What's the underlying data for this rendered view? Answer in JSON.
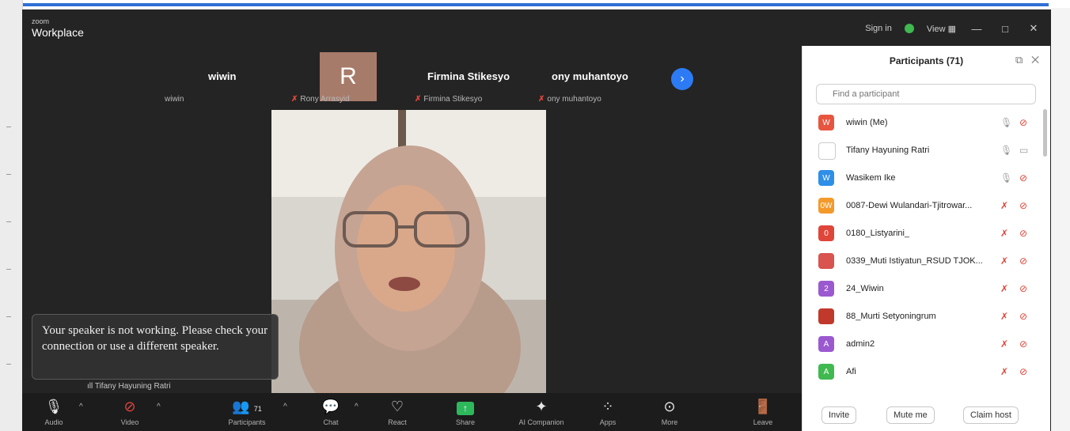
{
  "window": {
    "brand_small": "zoom",
    "brand_big": "Workplace",
    "sign_in": "Sign in",
    "view": "View",
    "minimize": "—",
    "maximize": "□",
    "close": "✕"
  },
  "gallery": {
    "r_initial": "R",
    "next_arrow": "›",
    "tiles": [
      {
        "name": "wiwin",
        "sub": "wiwin"
      },
      {
        "name": "",
        "sub": "Rony Arrasyid"
      },
      {
        "name": "Firmina Stikesyo",
        "sub": "Firmina Stikesyo"
      },
      {
        "name": "ony muhantoyo",
        "sub": "ony muhantoyo"
      }
    ]
  },
  "toast": {
    "message": "Your speaker is not working. Please check your connection or use a different speaker."
  },
  "active_speaker": "Tifany Hayuning Ratri",
  "toolbar": {
    "audio": "Audio",
    "video": "Video",
    "participants": "Participants",
    "participants_count": "71",
    "chat": "Chat",
    "react": "React",
    "share": "Share",
    "ai": "AI Companion",
    "apps": "Apps",
    "more": "More",
    "leave": "Leave"
  },
  "panel": {
    "title": "Participants (71)",
    "search_placeholder": "Find a participant",
    "participants": [
      {
        "name": "wiwin (Me)",
        "initials": "W",
        "color": "#e8553f",
        "muted": false,
        "video_off": true
      },
      {
        "name": "Tifany Hayuning Ratri",
        "initials": "",
        "color": "#ffffff",
        "muted": false,
        "video_off": false
      },
      {
        "name": "Wasikem Ike",
        "initials": "W",
        "color": "#2f8fe8",
        "muted": false,
        "video_off": true
      },
      {
        "name": "0087-Dewi Wulandari-Tjitrowar...",
        "initials": "0W",
        "color": "#f39a2b",
        "muted": true,
        "video_off": true
      },
      {
        "name": "0180_Listyarini_",
        "initials": "0",
        "color": "#e0453a",
        "muted": true,
        "video_off": true
      },
      {
        "name": "0339_Muti Istiyatun_RSUD TJOK...",
        "initials": "",
        "color": "#d9534f",
        "muted": true,
        "video_off": true
      },
      {
        "name": "24_Wiwin",
        "initials": "2",
        "color": "#9b59d0",
        "muted": true,
        "video_off": true
      },
      {
        "name": "88_Murti Setyoningrum",
        "initials": "",
        "color": "#c0392b",
        "muted": true,
        "video_off": true
      },
      {
        "name": "admin2",
        "initials": "A",
        "color": "#9b59d0",
        "muted": true,
        "video_off": true
      },
      {
        "name": "Afi",
        "initials": "A",
        "color": "#3fb950",
        "muted": true,
        "video_off": true
      }
    ],
    "invite": "Invite",
    "mute_me": "Mute me",
    "claim_host": "Claim host"
  }
}
